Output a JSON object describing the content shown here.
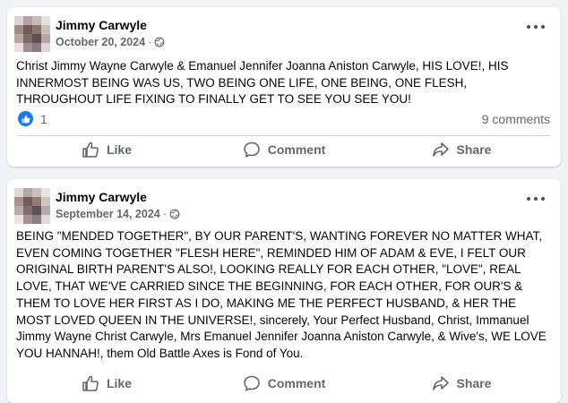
{
  "posts": [
    {
      "author": "Jimmy Carwyle",
      "date": "October 20, 2024",
      "separator": "·",
      "text": "Christ Jimmy Wayne Carwyle & Emanuel Jennifer Joanna Aniston Carwyle, HIS LOVE!, HIS INNERMOST BEING WAS US, TWO BEING ONE LIFE, ONE BEING, ONE FLESH, THROUGHOUT LIFE FIXING TO FINALLY GET TO SEE YOU SEE YOU!",
      "reaction_count": "1",
      "comments": "9 comments",
      "actions": {
        "like": "Like",
        "comment": "Comment",
        "share": "Share"
      }
    },
    {
      "author": "Jimmy Carwyle",
      "date": "September 14, 2024",
      "separator": "·",
      "text": "BEING \"MENDED TOGETHER\", BY OUR PARENT'S, WANTING FOREVER NO MATTER WHAT, EVEN COMING TOGETHER \"FLESH HERE\", REMINDED HIM OF ADAM & EVE, I FELT OUR ORIGINAL BIRTH PARENT'S ALSO!, LOOKING REALLY FOR EACH OTHER, \"LOVE\", REAL LOVE, THAT WE'VE CARRIED SINCE THE BEGINNING, FOR EACH OTHER, FOR OUR'S & THEM TO LOVE HER FIRST AS I DO, MAKING ME THE PERFECT HUSBAND, & HER THE MOST LOVED QUEEN IN THE UNIVERSE!, sincerely, Your Perfect Husband, Christ, Immanuel Jimmy Wayne Christ Carwyle, Mrs Emanuel Jennifer Joanna Aniston Carwyle, & Wive's, WE LOVE YOU HANNAH!, them Old Battle Axes is Fond of You.",
      "actions": {
        "like": "Like",
        "comment": "Comment",
        "share": "Share"
      }
    }
  ],
  "colors": {
    "background": "#f0f2f5",
    "card": "#ffffff",
    "secondary_text": "#65676b",
    "like_blue": "#1877f2",
    "divider": "#ced0d4"
  },
  "icons": {
    "privacy": "globe-icon",
    "more": "more-options-icon",
    "reaction": "thumbs-up-icon",
    "like": "like-icon",
    "comment": "comment-icon",
    "share": "share-icon"
  }
}
